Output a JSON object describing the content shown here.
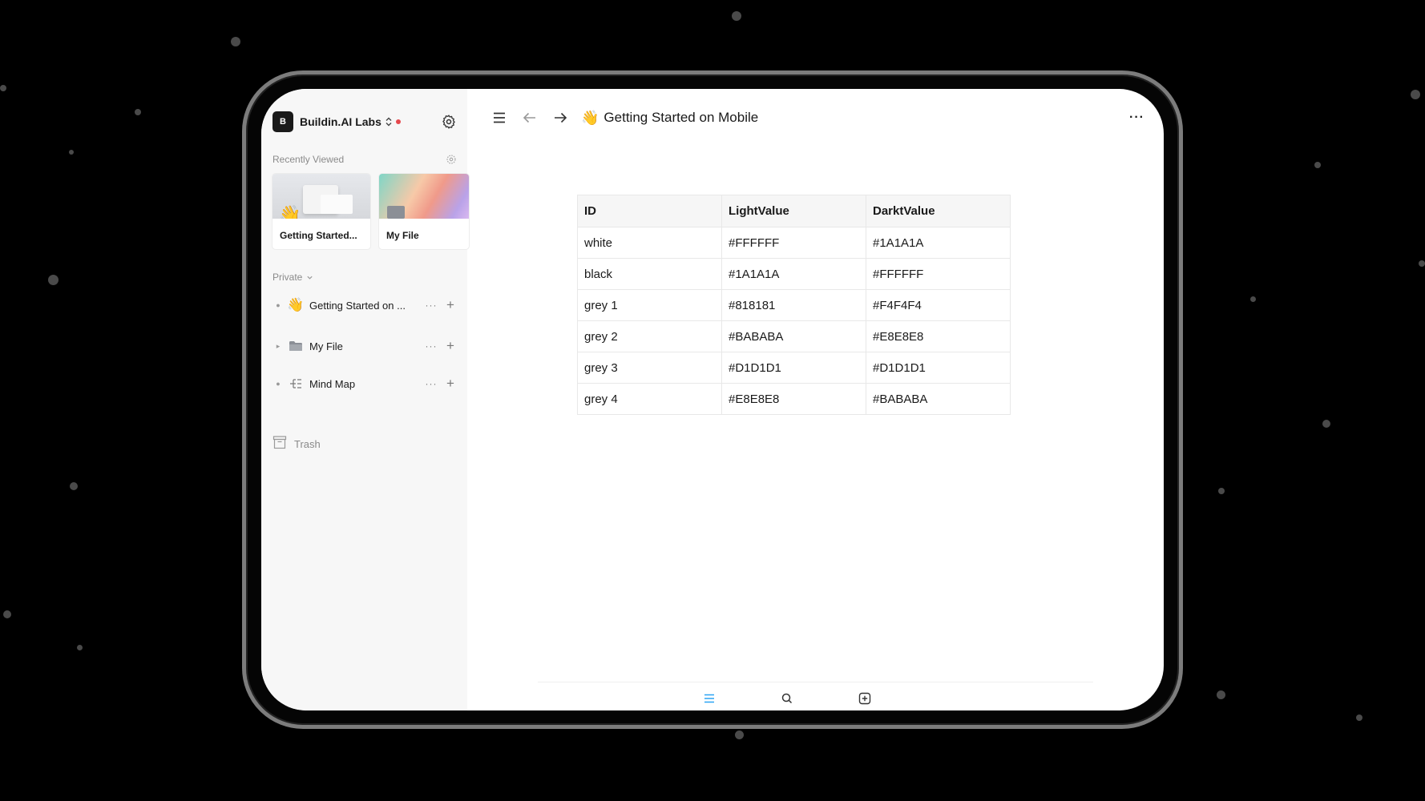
{
  "workspace": {
    "logo_letter": "B",
    "name": "Buildin.AI Labs"
  },
  "recently_viewed": {
    "label": "Recently Viewed",
    "cards": [
      {
        "title": "Getting Started...",
        "emoji": "👋"
      },
      {
        "title": "My File"
      }
    ]
  },
  "private": {
    "label": "Private"
  },
  "tree": [
    {
      "label": "Getting Started on ...",
      "emoji": "👋",
      "icon": "wave-emoji-icon"
    },
    {
      "label": "My File",
      "icon": "folder-icon"
    },
    {
      "label": "Mind Map",
      "icon": "mind-map-icon"
    }
  ],
  "tree_actions": {
    "more": "···",
    "add": "+"
  },
  "trash": {
    "label": "Trash"
  },
  "page": {
    "emoji": "👋",
    "title": "Getting Started on Mobile",
    "more": "···"
  },
  "table": {
    "headers": [
      "ID",
      "LightValue",
      "DarktValue"
    ],
    "rows": [
      [
        "white",
        "#FFFFFF",
        "#1A1A1A"
      ],
      [
        "black",
        "#1A1A1A",
        "#FFFFFF"
      ],
      [
        "grey 1",
        "#818181",
        "#F4F4F4"
      ],
      [
        "grey 2",
        "#BABABA",
        "#E8E8E8"
      ],
      [
        "grey 3",
        "#D1D1D1",
        "#D1D1D1"
      ],
      [
        "grey 4",
        "#E8E8E8",
        "#BABABA"
      ]
    ]
  },
  "colors": {
    "accent": "#2aa4f4",
    "notification_dot": "#e5484d",
    "text": "#1a1a1a",
    "muted": "#8a8a8a"
  }
}
